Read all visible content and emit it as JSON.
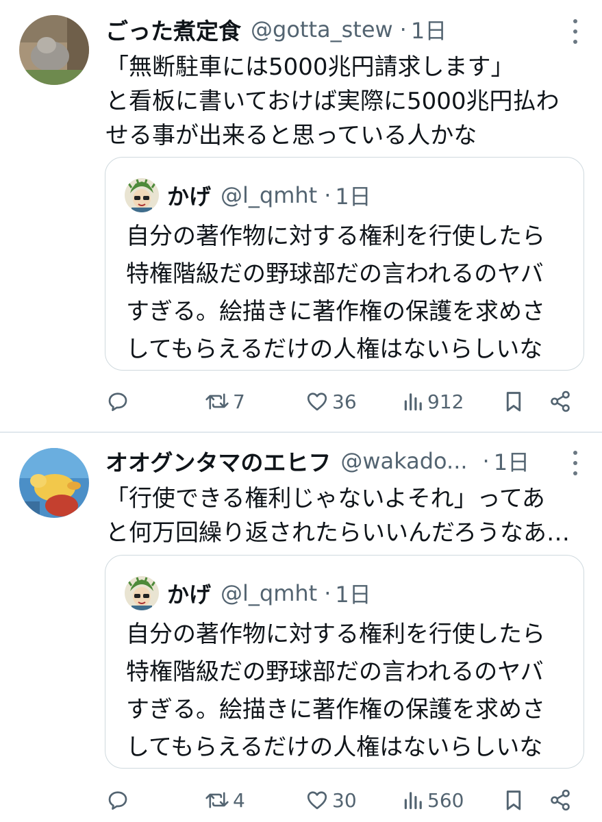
{
  "tweets": [
    {
      "author": {
        "name": "ごった煮定食",
        "handle": "@gotta_stew",
        "time": "1日"
      },
      "text_lines": [
        "「無断駐車には5000兆円請求します」",
        "と看板に書いておけば実際に5000兆円払わ",
        "せる事が出来ると思っている人かな"
      ],
      "quote": {
        "author": {
          "name": "かげ",
          "handle": "@l_qmht",
          "time": "1日"
        },
        "text_lines": [
          "自分の著作物に対する権利を行使したら",
          "特権階級だの野球部だの言われるのヤバ",
          "すぎる。絵描きに著作権の保護を求めさ",
          "してもらえるだけの人権はないらしいな"
        ]
      },
      "actions": {
        "retweets": "7",
        "likes": "36",
        "views": "912"
      }
    },
    {
      "author": {
        "name": "オオグンタマのエヒフ",
        "handle": "@wakado...",
        "time": "1日"
      },
      "text_lines": [
        "「行使できる権利じゃないよそれ」ってあ",
        "と何万回繰り返されたらいいんだろうなあ…"
      ],
      "quote": {
        "author": {
          "name": "かげ",
          "handle": "@l_qmht",
          "time": "1日"
        },
        "text_lines": [
          "自分の著作物に対する権利を行使したら",
          "特権階級だの野球部だの言われるのヤバ",
          "すぎる。絵描きに著作権の保護を求めさ",
          "してもらえるだけの人権はないらしいな"
        ]
      },
      "actions": {
        "retweets": "4",
        "likes": "30",
        "views": "560"
      }
    }
  ],
  "separator": "·",
  "icons": {
    "reply": "reply-icon",
    "retweet": "retweet-icon",
    "like": "like-icon",
    "views": "views-icon",
    "bookmark": "bookmark-icon",
    "share": "share-icon",
    "more": "more-icon"
  },
  "colors": {
    "text": "#0f1419",
    "secondary": "#536471",
    "border": "#cfd9de"
  }
}
